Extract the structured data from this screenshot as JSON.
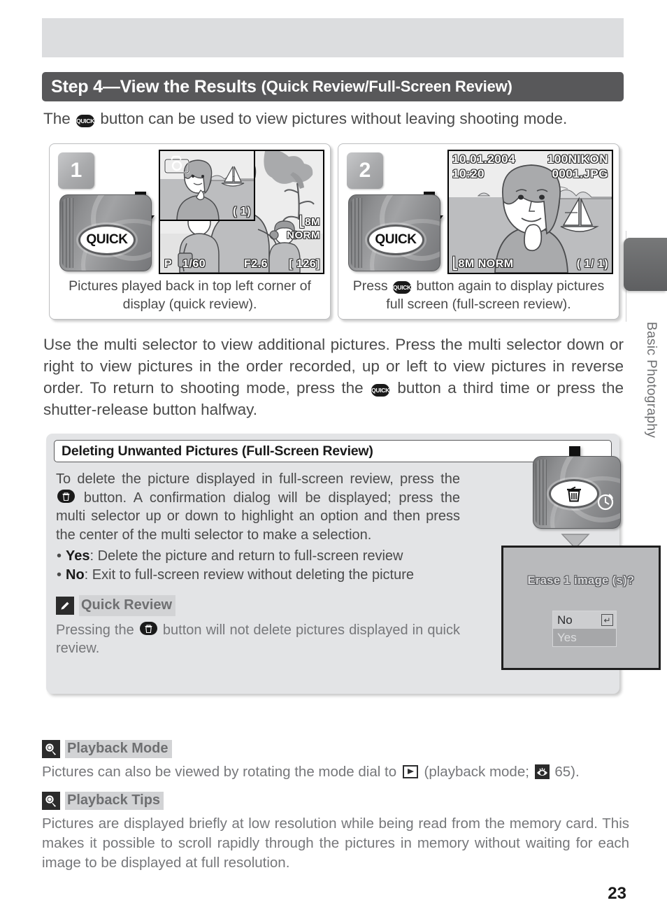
{
  "section": {
    "step_title": "Step 4—View the Results",
    "step_subtitle": "(Quick Review/Full-Screen Review)"
  },
  "intro": {
    "before": "The",
    "after": "button can be used to view pictures without leaving shooting mode.",
    "button_icon": "quick-button-icon",
    "button_label": "QUICK"
  },
  "steps": [
    {
      "number": "1",
      "button_label": "QUICK",
      "caption": "Pictures played back in top left corner of display (quick review).",
      "lcd": {
        "mode": "P",
        "shutter": "1/60",
        "aperture": "F2.6",
        "frames_remaining": "[ 126]",
        "image_size": "8M",
        "quality": "NORM",
        "thumb_counter": "(  1)",
        "camera_icon": "camera-icon"
      }
    },
    {
      "number": "2",
      "button_label": "QUICK",
      "caption_before": "Press",
      "caption_after": "button again to display pictures full screen (full-screen review).",
      "lcd": {
        "date": "10.01.2004",
        "time": "10:20",
        "folder": "100NIKON",
        "filename": "0001.JPG",
        "image_size": "8M",
        "quality": "NORM",
        "counter": "(     1/      1)"
      }
    }
  ],
  "body_paragraph": {
    "part1": "Use the multi selector to view additional pictures.  Press the multi selector down or right to view pictures in the order recorded, up or left to view pictures in reverse order.  To return to shooting mode, press the",
    "part2": "button a third time or press the shutter-release button halfway."
  },
  "infobox": {
    "title": "Deleting Unwanted Pictures (Full-Screen Review)",
    "paragraph_part1": "To delete the picture displayed in full-screen review, press the",
    "paragraph_part2": "button.  A confirmation dialog will be displayed; press the multi selector up or down to highlight an option and then press the center of the multi selector to make a selection.",
    "bullets": [
      {
        "term": "Yes",
        "text": ": Delete the picture and return to full-screen review"
      },
      {
        "term": "No",
        "text": ": Exit to full-screen review without deleting the picture"
      }
    ],
    "quick_review": {
      "icon": "pencil-icon",
      "title": "Quick Review",
      "text_part1": "Pressing the",
      "text_part2": "button will not delete pictures displayed in quick review."
    },
    "erase_dialog": {
      "question": "Erase 1 image (s)?",
      "options": [
        {
          "label": "No",
          "selected": true,
          "enter_glyph": "↵"
        },
        {
          "label": "Yes",
          "selected": false
        }
      ]
    },
    "camera": {
      "button_icon": "trash-icon",
      "self_timer_icon": "self-timer-icon"
    }
  },
  "side_tab": {
    "label": "Basic Photography"
  },
  "notes": [
    {
      "icon": "magnifier-icon",
      "title": "Playback Mode",
      "text_part1": "Pictures can also be viewed by rotating the mode dial to",
      "text_part2": "(playback mode;",
      "text_part3": "65)."
    },
    {
      "icon": "magnifier-icon",
      "title": "Playback Tips",
      "text": "Pictures are displayed briefly at low resolution while being read from the memory card.  This makes it possible to scroll rapidly through the pictures in memory without waiting for each image to be displayed at full resolution."
    }
  ],
  "page_number": "23",
  "colors": {
    "section_bar": "#58585a",
    "top_band": "#dcdddf",
    "infobox": "#e3e4e6",
    "body_text": "#4a4a4a",
    "note_text": "#76777a"
  }
}
